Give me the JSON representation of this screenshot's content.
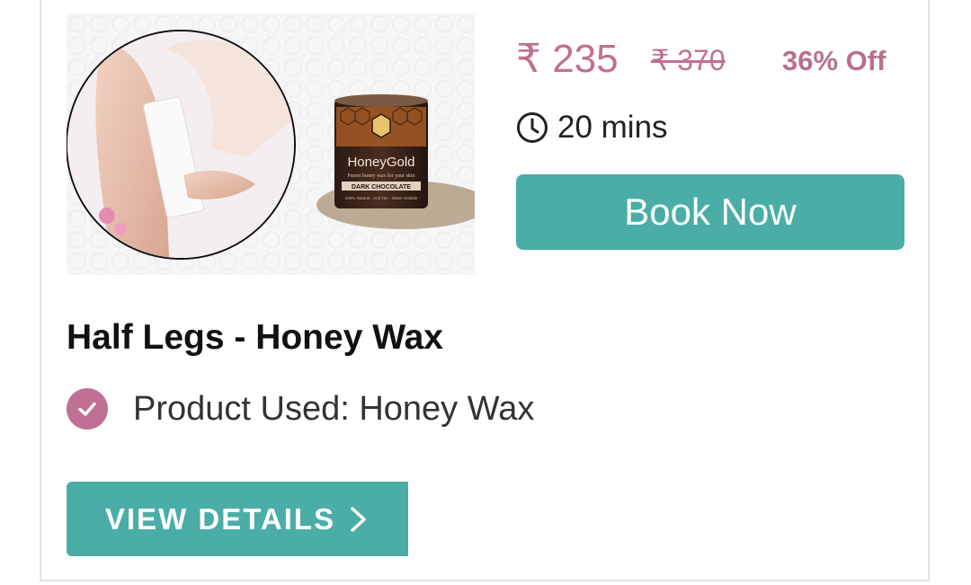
{
  "service": {
    "price_current": "₹ 235",
    "price_original": "₹ 370",
    "discount": "36% Off",
    "duration": "20 mins",
    "book_label": "Book Now",
    "title": "Half Legs - Honey Wax",
    "product_used": "Product Used: Honey Wax",
    "view_details_label": "VIEW DETAILS",
    "image": {
      "brand_text": "HoneyGold",
      "tagline_text": "Purest honey wax for your skin",
      "variant_text": "DARK CHOCOLATE",
      "claims_text": "100% Natural · Anti Tan · Water Soluble"
    }
  },
  "colors": {
    "accent_teal": "#4aaea6",
    "price_pink": "#c07092",
    "check_badge": "#c07092"
  },
  "icons": {
    "duration": "clock-icon",
    "product_used": "check-circle-icon",
    "view_details": "chevron-right-icon"
  }
}
